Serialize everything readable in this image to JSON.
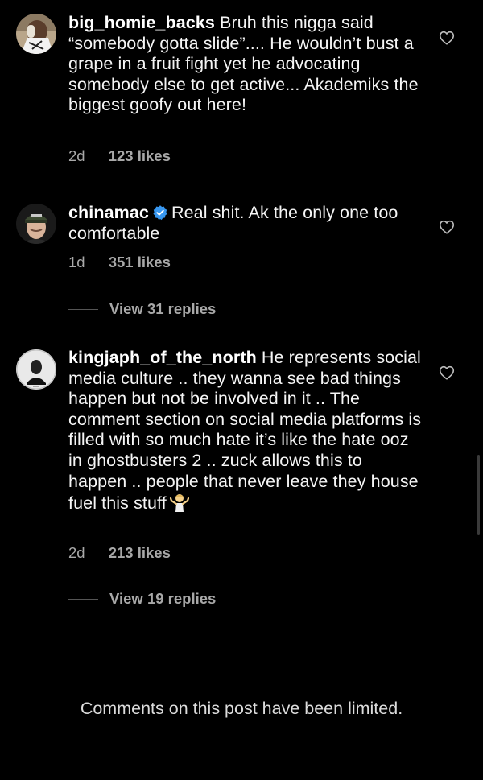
{
  "comments": [
    {
      "username": "big_homie_backs",
      "text": "Bruh this nigga said “somebody gotta slide”.... He wouldn’t bust a grape in a fruit fight yet he advocating somebody else to get active... Akademiks the biggest goofy out here!",
      "age": "2d",
      "likes": "123 likes"
    },
    {
      "username": "chinamac",
      "verified": true,
      "text": "Real shit. Ak the only one too comfortable",
      "age": "1d",
      "likes": "351 likes",
      "replies_label": "View 31 replies"
    },
    {
      "username": "kingjaph_of_the_north",
      "text": "He represents social media culture .. they wanna see bad things happen but not be involved in it .. The comment section on social media platforms is filled with so much hate it’s like the hate ooz in ghostbusters 2 .. zuck allows this to happen .. people that never leave they house fuel this stuff",
      "emoji": "person-shrugging-emoji",
      "age": "2d",
      "likes": "213 likes",
      "replies_label": "View 19 replies"
    }
  ],
  "footer": {
    "limited_notice": "Comments on this post have been limited."
  },
  "icons": {
    "like": "heart-outline-icon",
    "verified": "verified-badge-icon"
  },
  "colors": {
    "background": "#000000",
    "text": "#f5f5f5",
    "secondary_text": "#a8a8a8",
    "verified_blue": "#3897f0"
  }
}
